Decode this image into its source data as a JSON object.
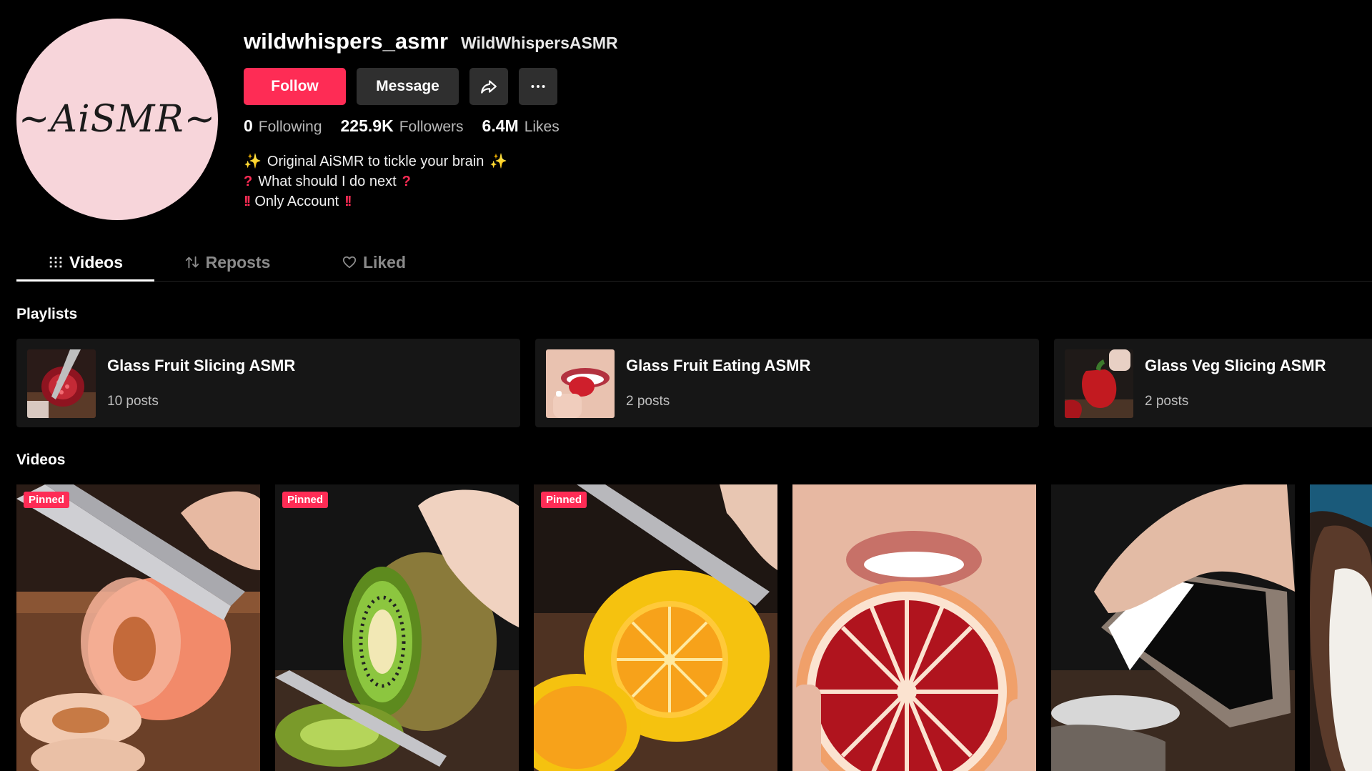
{
  "profile": {
    "avatar_text": "~AiSMR~",
    "username": "wildwhispers_asmr",
    "nickname": "WildWhispersASMR",
    "follow_label": "Follow",
    "message_label": "Message",
    "stats": {
      "following_count": "0",
      "following_label": "Following",
      "followers_count": "225.9K",
      "followers_label": "Followers",
      "likes_count": "6.4M",
      "likes_label": "Likes"
    },
    "bio": [
      "Original AiSMR to tickle your brain",
      "What should I do next",
      "Only Account"
    ]
  },
  "tabs": [
    {
      "label": "Videos",
      "icon": "grid-icon",
      "active": true
    },
    {
      "label": "Reposts",
      "icon": "repost-icon",
      "active": false
    },
    {
      "label": "Liked",
      "icon": "heart-icon",
      "active": false
    }
  ],
  "playlists": {
    "title": "Playlists",
    "items": [
      {
        "title": "Glass Fruit Slicing ASMR",
        "count": "10 posts"
      },
      {
        "title": "Glass Fruit Eating ASMR",
        "count": "2 posts"
      },
      {
        "title": "Glass Veg Slicing ASMR",
        "count": "2 posts"
      }
    ]
  },
  "videos": {
    "title": "Videos",
    "pinned_label": "Pinned",
    "items": [
      {
        "subject": "glass peach slicing",
        "pinned": true
      },
      {
        "subject": "glass kiwi slicing",
        "pinned": true
      },
      {
        "subject": "glass lemon slicing",
        "pinned": true
      },
      {
        "subject": "glass grapefruit eating",
        "pinned": false
      },
      {
        "subject": "glass stone breaking",
        "pinned": false
      },
      {
        "subject": "glass coconut",
        "pinned": false
      }
    ]
  },
  "colors": {
    "accent": "#fe2c55",
    "background": "#000000",
    "card": "#161616",
    "button_secondary": "#2f2f2f",
    "avatar_bg": "#f7d5da"
  }
}
